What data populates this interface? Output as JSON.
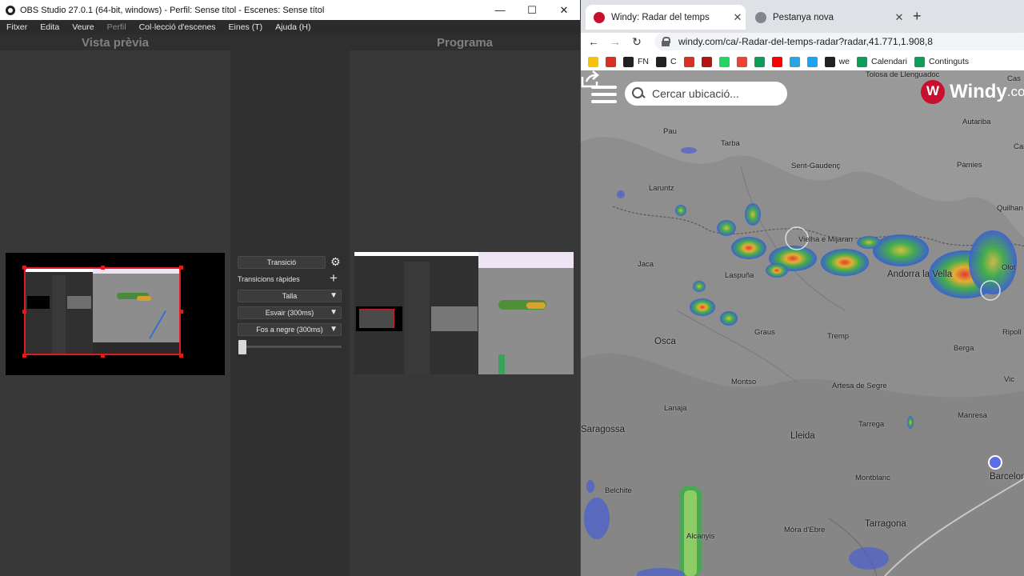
{
  "obs": {
    "title": "OBS Studio 27.0.1 (64-bit, windows) - Perfil: Sense títol - Escenes: Sense títol",
    "window_controls": {
      "minimize": "—",
      "maximize": "☐",
      "close": "✕"
    },
    "menu": [
      "Fitxer",
      "Edita",
      "Veure",
      "Perfil",
      "Col·lecció d'escenes",
      "Eines (T)",
      "Ajuda (H)"
    ],
    "preview_title": "Vista prèvia",
    "program_title": "Programa",
    "transition": {
      "button_label": "Transició",
      "quick_label": "Transicions ràpides",
      "options": [
        "Talla",
        "Esvair (300ms)",
        "Fos a negre (300ms)"
      ],
      "slider_value": 0
    }
  },
  "chrome": {
    "tabs": [
      {
        "label": "Windy: Radar del temps",
        "active": true
      },
      {
        "label": "Pestanya nova",
        "active": false
      }
    ],
    "url": "windy.com/ca/-Radar-del-temps-radar?radar,41.771,1.908,8",
    "bookmarks": [
      {
        "label": "",
        "color": "#f4c20d"
      },
      {
        "label": "",
        "color": "#d93025"
      },
      {
        "label": "FN",
        "color": "#202124"
      },
      {
        "label": "C",
        "color": "#202124"
      },
      {
        "label": "",
        "color": "#d93025"
      },
      {
        "label": "",
        "color": "#b31412"
      },
      {
        "label": "",
        "color": "#25d366"
      },
      {
        "label": "",
        "color": "#ea4335"
      },
      {
        "label": "",
        "color": "#0f9d58"
      },
      {
        "label": "",
        "color": "#ff0000"
      },
      {
        "label": "",
        "color": "#2aa3e0"
      },
      {
        "label": "",
        "color": "#1da1f2"
      },
      {
        "label": "we",
        "color": "#202124"
      },
      {
        "label": "Calendari",
        "color": "#0f9d58"
      },
      {
        "label": "Continguts",
        "color": "#0f9d58"
      }
    ]
  },
  "map": {
    "search_placeholder": "Cercar ubicació...",
    "logo": "Windy",
    "logo_suffix": ".com",
    "cities": [
      {
        "name": "Tolosa de Llenguadoc",
        "big": false
      },
      {
        "name": "Autariba",
        "big": false
      },
      {
        "name": "Pau",
        "big": false
      },
      {
        "name": "Tarba",
        "big": false
      },
      {
        "name": "Sent-Gaudenç",
        "big": false
      },
      {
        "name": "Pàmies",
        "big": false
      },
      {
        "name": "Laruntz",
        "big": false
      },
      {
        "name": "Quilhan",
        "big": false
      },
      {
        "name": "Vielha e Mijaran",
        "big": false
      },
      {
        "name": "Jaca",
        "big": false
      },
      {
        "name": "Laspuña",
        "big": false
      },
      {
        "name": "Andorra la Vella",
        "big": true
      },
      {
        "name": "Olot",
        "big": false
      },
      {
        "name": "Osca",
        "big": true
      },
      {
        "name": "Graus",
        "big": false
      },
      {
        "name": "Tremp",
        "big": false
      },
      {
        "name": "Ripoll",
        "big": false
      },
      {
        "name": "Berga",
        "big": false
      },
      {
        "name": "Vic",
        "big": false
      },
      {
        "name": "Montso",
        "big": false
      },
      {
        "name": "Artesa de Segre",
        "big": false
      },
      {
        "name": "Lanaja",
        "big": false
      },
      {
        "name": "Saragossa",
        "big": true
      },
      {
        "name": "Lleida",
        "big": true
      },
      {
        "name": "Tarrega",
        "big": false
      },
      {
        "name": "Manresa",
        "big": false
      },
      {
        "name": "Belchite",
        "big": false
      },
      {
        "name": "Montblanc",
        "big": false
      },
      {
        "name": "Barcelona",
        "big": true
      },
      {
        "name": "Alcanyis",
        "big": false
      },
      {
        "name": "Móra d'Ebre",
        "big": false
      },
      {
        "name": "Tarragona",
        "big": true
      },
      {
        "name": "Cas",
        "big": false
      },
      {
        "name": "Car",
        "big": false
      }
    ]
  }
}
